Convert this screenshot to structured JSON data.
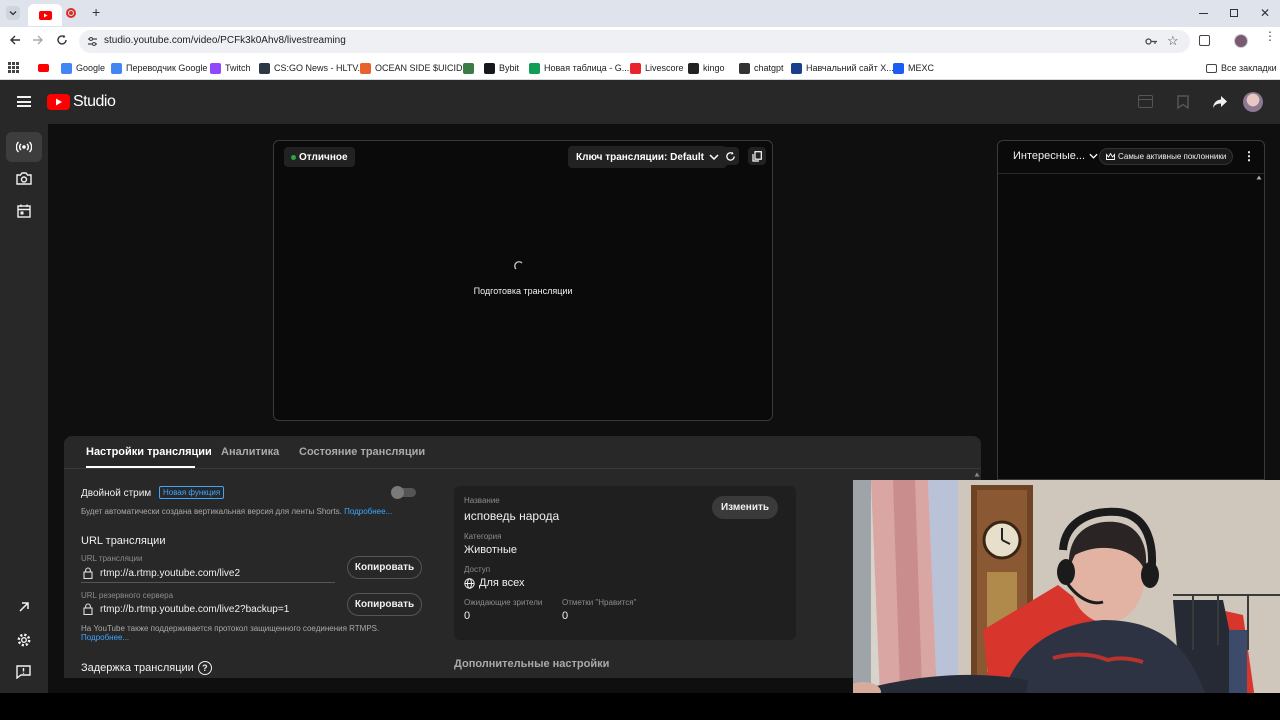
{
  "browser": {
    "url": "studio.youtube.com/video/PCFk3k0Ahv8/livestreaming",
    "new_tab": "+",
    "bookmarks": [
      {
        "label": "Google",
        "color": "#4285f4"
      },
      {
        "label": "Переводчик Google",
        "color": "#4285f4"
      },
      {
        "label": "Twitch",
        "color": "#9146ff"
      },
      {
        "label": "CS:GO News - HLTV...",
        "color": "#2d3844"
      },
      {
        "label": "OCEAN SIDE $UICID...",
        "color": "#e8612c"
      },
      {
        "label": "",
        "color": "#3a7d44"
      },
      {
        "label": "Bybit",
        "color": "#17181e"
      },
      {
        "label": "Новая таблица - G...",
        "color": "#0f9d58"
      },
      {
        "label": "Livescore",
        "color": "#e8242a"
      },
      {
        "label": "kingo",
        "color": "#222222"
      },
      {
        "label": "chatgpt",
        "color": "#333333"
      },
      {
        "label": "Навчальний сайт Х...",
        "color": "#1a3e8c"
      },
      {
        "label": "MEXC",
        "color": "#1b5cf2"
      }
    ],
    "all_bookmarks": "Все закладки"
  },
  "studio": {
    "logo_text": "Studio"
  },
  "preview": {
    "status": "Отличное",
    "stream_key_label": "Ключ трансляции: Default",
    "preparing": "Подготовка трансляции"
  },
  "chat": {
    "mode": "Интересные...",
    "top_fans": "Самые активные поклонники"
  },
  "settings": {
    "tabs": [
      "Настройки трансляции",
      "Аналитика",
      "Состояние трансляции"
    ],
    "dual_stream_label": "Двойной стрим",
    "new_badge": "Новая функция",
    "dual_stream_desc": "Будет автоматически создана вертикальная версия для ленты Shorts.",
    "more_link": "Подробнее...",
    "url_section_title": "URL трансляции",
    "url_label": "URL трансляции",
    "url_value": "rtmp://a.rtmp.youtube.com/live2",
    "backup_label": "URL резервного сервера",
    "backup_value": "rtmp://b.rtmp.youtube.com/live2?backup=1",
    "copy_button": "Копировать",
    "rtmps_note": "На YouTube также поддерживается протокол защищенного соединения RTMPS.",
    "rtmps_more": "Подробнее...",
    "latency_title": "Задержка трансляции",
    "latency_help": "?"
  },
  "info": {
    "title_label": "Название",
    "title_value": "исповедь народа",
    "edit_button": "Изменить",
    "category_label": "Категория",
    "category_value": "Животные",
    "access_label": "Доступ",
    "access_value": "Для всех",
    "waiting_label": "Ожидающие зрители",
    "waiting_value": "0",
    "likes_label": "Отметки \"Нравится\"",
    "likes_value": "0",
    "extra_settings": "Дополнительные настройки"
  },
  "colors": {
    "accent_blue": "#3ea6ff",
    "status_green": "#2ba640",
    "yt_red": "#ff0000"
  }
}
